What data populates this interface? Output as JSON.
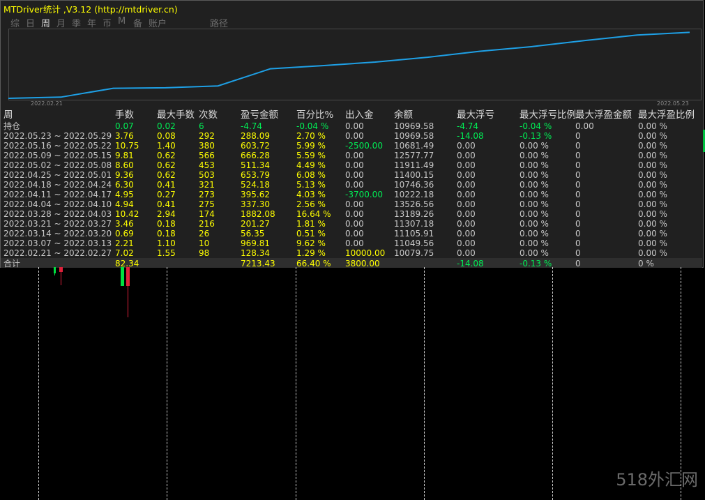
{
  "window": {
    "title": "MTDriver统计 ,V3.12 (http://mtdriver.cn)"
  },
  "tabs": [
    {
      "label": "综",
      "active": false
    },
    {
      "label": "日",
      "active": false
    },
    {
      "label": "周",
      "active": true
    },
    {
      "label": "月",
      "active": false
    },
    {
      "label": "季",
      "active": false
    },
    {
      "label": "年",
      "active": false
    },
    {
      "label": "币",
      "active": false
    },
    {
      "label": "M",
      "active": false
    },
    {
      "label": "备",
      "active": false
    },
    {
      "label": "账户",
      "active": false
    },
    {
      "label": "路径",
      "active": false
    }
  ],
  "chart_data": {
    "type": "line",
    "x_start_label": "2022.02.21",
    "x_end_label": "2022.05.23",
    "line_color": "#1ea0e6",
    "x": [
      "2022.02.21",
      "2022.02.28",
      "2022.03.07",
      "2022.03.14",
      "2022.03.21",
      "2022.03.28",
      "2022.04.04",
      "2022.04.11",
      "2022.04.18",
      "2022.04.25",
      "2022.05.02",
      "2022.05.09",
      "2022.05.16",
      "2022.05.23"
    ],
    "values": [
      0,
      128.34,
      1098.15,
      1154.5,
      1355.77,
      3237.85,
      3575.15,
      3970.77,
      4494.95,
      5148.74,
      5660.08,
      6326.36,
      6930.08,
      7218.17
    ],
    "ylim": [
      0,
      7400
    ]
  },
  "table": {
    "headers": [
      "周",
      "手数",
      "最大手数",
      "次数",
      "盈亏金额",
      "百分比%",
      "出入金",
      "余额",
      "最大浮亏",
      "最大浮亏比例",
      "最大浮盈金额",
      "最大浮盈比例"
    ],
    "holding": {
      "label": "持仓",
      "cells": [
        {
          "text": "0.07",
          "c": "green"
        },
        {
          "text": "0.02",
          "c": "green"
        },
        {
          "text": "6",
          "c": "green"
        },
        {
          "text": "-4.74",
          "c": "green"
        },
        {
          "text": "-0.04 %",
          "c": "green"
        },
        {
          "text": "0.00",
          "c": "white"
        },
        {
          "text": "10969.58",
          "c": "white"
        },
        {
          "text": "-4.74",
          "c": "green"
        },
        {
          "text": "-0.04 %",
          "c": "green"
        },
        {
          "text": "0.00",
          "c": "white"
        },
        {
          "text": "0.00 %",
          "c": "white"
        }
      ]
    },
    "rows": [
      {
        "label": "2022.05.23 ~ 2022.05.29",
        "cells": [
          {
            "text": "3.76",
            "c": "yellow"
          },
          {
            "text": "0.08",
            "c": "yellow"
          },
          {
            "text": "292",
            "c": "yellow"
          },
          {
            "text": "288.09",
            "c": "yellow"
          },
          {
            "text": "2.70 %",
            "c": "yellow"
          },
          {
            "text": "0.00",
            "c": "white"
          },
          {
            "text": "10969.58",
            "c": "white"
          },
          {
            "text": "-14.08",
            "c": "green"
          },
          {
            "text": "-0.13 %",
            "c": "green"
          },
          {
            "text": "0",
            "c": "white"
          },
          {
            "text": "0.00 %",
            "c": "white"
          }
        ]
      },
      {
        "label": "2022.05.16 ~ 2022.05.22",
        "cells": [
          {
            "text": "10.75",
            "c": "yellow"
          },
          {
            "text": "1.40",
            "c": "yellow"
          },
          {
            "text": "380",
            "c": "yellow"
          },
          {
            "text": "603.72",
            "c": "yellow"
          },
          {
            "text": "5.99 %",
            "c": "yellow"
          },
          {
            "text": "-2500.00",
            "c": "green"
          },
          {
            "text": "10681.49",
            "c": "white"
          },
          {
            "text": "0.00",
            "c": "white"
          },
          {
            "text": "0.00 %",
            "c": "white"
          },
          {
            "text": "0",
            "c": "white"
          },
          {
            "text": "0.00 %",
            "c": "white"
          }
        ]
      },
      {
        "label": "2022.05.09 ~ 2022.05.15",
        "cells": [
          {
            "text": "9.81",
            "c": "yellow"
          },
          {
            "text": "0.62",
            "c": "yellow"
          },
          {
            "text": "566",
            "c": "yellow"
          },
          {
            "text": "666.28",
            "c": "yellow"
          },
          {
            "text": "5.59 %",
            "c": "yellow"
          },
          {
            "text": "0.00",
            "c": "white"
          },
          {
            "text": "12577.77",
            "c": "white"
          },
          {
            "text": "0.00",
            "c": "white"
          },
          {
            "text": "0.00 %",
            "c": "white"
          },
          {
            "text": "0",
            "c": "white"
          },
          {
            "text": "0.00 %",
            "c": "white"
          }
        ]
      },
      {
        "label": "2022.05.02 ~ 2022.05.08",
        "cells": [
          {
            "text": "8.60",
            "c": "yellow"
          },
          {
            "text": "0.62",
            "c": "yellow"
          },
          {
            "text": "453",
            "c": "yellow"
          },
          {
            "text": "511.34",
            "c": "yellow"
          },
          {
            "text": "4.49 %",
            "c": "yellow"
          },
          {
            "text": "0.00",
            "c": "white"
          },
          {
            "text": "11911.49",
            "c": "white"
          },
          {
            "text": "0.00",
            "c": "white"
          },
          {
            "text": "0.00 %",
            "c": "white"
          },
          {
            "text": "0",
            "c": "white"
          },
          {
            "text": "0.00 %",
            "c": "white"
          }
        ]
      },
      {
        "label": "2022.04.25 ~ 2022.05.01",
        "cells": [
          {
            "text": "9.36",
            "c": "yellow"
          },
          {
            "text": "0.62",
            "c": "yellow"
          },
          {
            "text": "503",
            "c": "yellow"
          },
          {
            "text": "653.79",
            "c": "yellow"
          },
          {
            "text": "6.08 %",
            "c": "yellow"
          },
          {
            "text": "0.00",
            "c": "white"
          },
          {
            "text": "11400.15",
            "c": "white"
          },
          {
            "text": "0.00",
            "c": "white"
          },
          {
            "text": "0.00 %",
            "c": "white"
          },
          {
            "text": "0",
            "c": "white"
          },
          {
            "text": "0.00 %",
            "c": "white"
          }
        ]
      },
      {
        "label": "2022.04.18 ~ 2022.04.24",
        "cells": [
          {
            "text": "6.30",
            "c": "yellow"
          },
          {
            "text": "0.41",
            "c": "yellow"
          },
          {
            "text": "321",
            "c": "yellow"
          },
          {
            "text": "524.18",
            "c": "yellow"
          },
          {
            "text": "5.13 %",
            "c": "yellow"
          },
          {
            "text": "0.00",
            "c": "white"
          },
          {
            "text": "10746.36",
            "c": "white"
          },
          {
            "text": "0.00",
            "c": "white"
          },
          {
            "text": "0.00 %",
            "c": "white"
          },
          {
            "text": "0",
            "c": "white"
          },
          {
            "text": "0.00 %",
            "c": "white"
          }
        ]
      },
      {
        "label": "2022.04.11 ~ 2022.04.17",
        "cells": [
          {
            "text": "4.95",
            "c": "yellow"
          },
          {
            "text": "0.27",
            "c": "yellow"
          },
          {
            "text": "273",
            "c": "yellow"
          },
          {
            "text": "395.62",
            "c": "yellow"
          },
          {
            "text": "4.03 %",
            "c": "yellow"
          },
          {
            "text": "-3700.00",
            "c": "green"
          },
          {
            "text": "10222.18",
            "c": "white"
          },
          {
            "text": "0.00",
            "c": "white"
          },
          {
            "text": "0.00 %",
            "c": "white"
          },
          {
            "text": "0",
            "c": "white"
          },
          {
            "text": "0.00 %",
            "c": "white"
          }
        ]
      },
      {
        "label": "2022.04.04 ~ 2022.04.10",
        "cells": [
          {
            "text": "4.94",
            "c": "yellow"
          },
          {
            "text": "0.41",
            "c": "yellow"
          },
          {
            "text": "275",
            "c": "yellow"
          },
          {
            "text": "337.30",
            "c": "yellow"
          },
          {
            "text": "2.56 %",
            "c": "yellow"
          },
          {
            "text": "0.00",
            "c": "white"
          },
          {
            "text": "13526.56",
            "c": "white"
          },
          {
            "text": "0.00",
            "c": "white"
          },
          {
            "text": "0.00 %",
            "c": "white"
          },
          {
            "text": "0",
            "c": "white"
          },
          {
            "text": "0.00 %",
            "c": "white"
          }
        ]
      },
      {
        "label": "2022.03.28 ~ 2022.04.03",
        "cells": [
          {
            "text": "10.42",
            "c": "yellow"
          },
          {
            "text": "2.94",
            "c": "yellow"
          },
          {
            "text": "174",
            "c": "yellow"
          },
          {
            "text": "1882.08",
            "c": "yellow"
          },
          {
            "text": "16.64 %",
            "c": "yellow"
          },
          {
            "text": "0.00",
            "c": "white"
          },
          {
            "text": "13189.26",
            "c": "white"
          },
          {
            "text": "0.00",
            "c": "white"
          },
          {
            "text": "0.00 %",
            "c": "white"
          },
          {
            "text": "0",
            "c": "white"
          },
          {
            "text": "0.00 %",
            "c": "white"
          }
        ]
      },
      {
        "label": "2022.03.21 ~ 2022.03.27",
        "cells": [
          {
            "text": "3.46",
            "c": "yellow"
          },
          {
            "text": "0.18",
            "c": "yellow"
          },
          {
            "text": "216",
            "c": "yellow"
          },
          {
            "text": "201.27",
            "c": "yellow"
          },
          {
            "text": "1.81 %",
            "c": "yellow"
          },
          {
            "text": "0.00",
            "c": "white"
          },
          {
            "text": "11307.18",
            "c": "white"
          },
          {
            "text": "0.00",
            "c": "white"
          },
          {
            "text": "0.00 %",
            "c": "white"
          },
          {
            "text": "0",
            "c": "white"
          },
          {
            "text": "0.00 %",
            "c": "white"
          }
        ]
      },
      {
        "label": "2022.03.14 ~ 2022.03.20",
        "cells": [
          {
            "text": "0.69",
            "c": "yellow"
          },
          {
            "text": "0.18",
            "c": "yellow"
          },
          {
            "text": "26",
            "c": "yellow"
          },
          {
            "text": "56.35",
            "c": "yellow"
          },
          {
            "text": "0.51 %",
            "c": "yellow"
          },
          {
            "text": "0.00",
            "c": "white"
          },
          {
            "text": "11105.91",
            "c": "white"
          },
          {
            "text": "0.00",
            "c": "white"
          },
          {
            "text": "0.00 %",
            "c": "white"
          },
          {
            "text": "0",
            "c": "white"
          },
          {
            "text": "0.00 %",
            "c": "white"
          }
        ]
      },
      {
        "label": "2022.03.07 ~ 2022.03.13",
        "cells": [
          {
            "text": "2.21",
            "c": "yellow"
          },
          {
            "text": "1.10",
            "c": "yellow"
          },
          {
            "text": "10",
            "c": "yellow"
          },
          {
            "text": "969.81",
            "c": "yellow"
          },
          {
            "text": "9.62 %",
            "c": "yellow"
          },
          {
            "text": "0.00",
            "c": "white"
          },
          {
            "text": "11049.56",
            "c": "white"
          },
          {
            "text": "0.00",
            "c": "white"
          },
          {
            "text": "0.00 %",
            "c": "white"
          },
          {
            "text": "0",
            "c": "white"
          },
          {
            "text": "0.00 %",
            "c": "white"
          }
        ]
      },
      {
        "label": "2022.02.21 ~ 2022.02.27",
        "cells": [
          {
            "text": "7.02",
            "c": "yellow"
          },
          {
            "text": "1.55",
            "c": "yellow"
          },
          {
            "text": "98",
            "c": "yellow"
          },
          {
            "text": "128.34",
            "c": "yellow"
          },
          {
            "text": "1.29 %",
            "c": "yellow"
          },
          {
            "text": "10000.00",
            "c": "yellow"
          },
          {
            "text": "10079.75",
            "c": "white"
          },
          {
            "text": "0.00",
            "c": "white"
          },
          {
            "text": "0.00 %",
            "c": "white"
          },
          {
            "text": "0",
            "c": "white"
          },
          {
            "text": "0.00 %",
            "c": "white"
          }
        ]
      }
    ],
    "total": {
      "label": "合计",
      "cells": [
        {
          "text": "82.34",
          "c": "yellow"
        },
        {
          "text": "",
          "c": "white"
        },
        {
          "text": "",
          "c": "white"
        },
        {
          "text": "7213.43",
          "c": "yellow"
        },
        {
          "text": "66.40 %",
          "c": "yellow"
        },
        {
          "text": "3800.00",
          "c": "yellow"
        },
        {
          "text": "",
          "c": "white"
        },
        {
          "text": "-14.08",
          "c": "green"
        },
        {
          "text": "-0.13 %",
          "c": "green"
        },
        {
          "text": "0",
          "c": "white"
        },
        {
          "text": "0 %",
          "c": "white"
        }
      ]
    }
  },
  "watermark": "518外汇网",
  "colors": {
    "yellow": "#ffff00",
    "green": "#00ee55",
    "line": "#1ea0e6"
  }
}
